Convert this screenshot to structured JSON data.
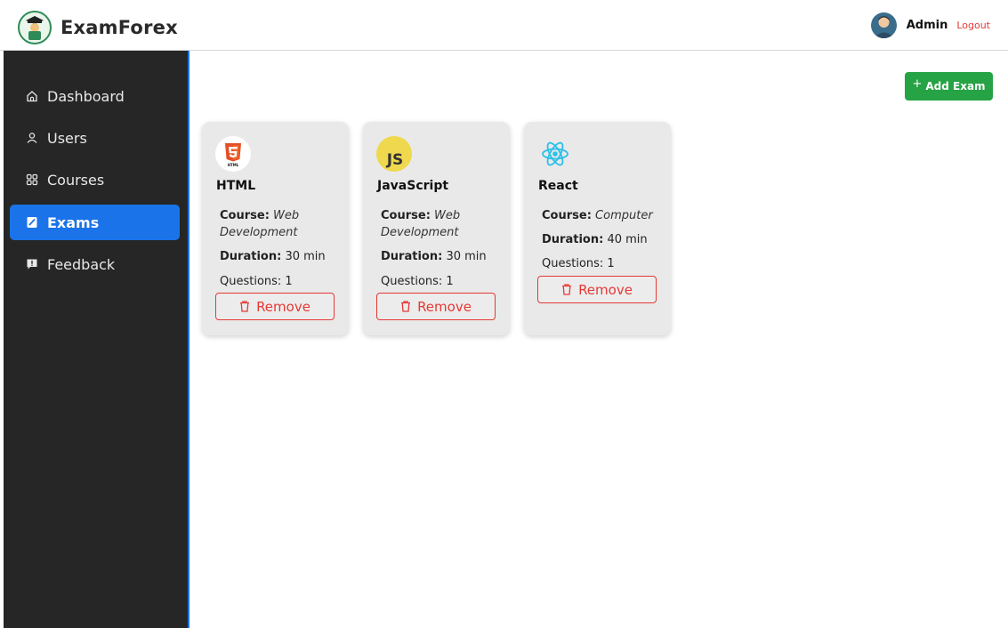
{
  "header": {
    "brand_name": "ExamForex",
    "admin_name": "Admin",
    "logout_label": "Logout"
  },
  "sidebar": {
    "items": [
      {
        "label": "Dashboard",
        "icon": "home-icon",
        "active": false
      },
      {
        "label": "Users",
        "icon": "user-icon",
        "active": false
      },
      {
        "label": "Courses",
        "icon": "grid-icon",
        "active": false
      },
      {
        "label": "Exams",
        "icon": "exam-icon",
        "active": true
      },
      {
        "label": "Feedback",
        "icon": "feedback-icon",
        "active": false
      }
    ]
  },
  "main": {
    "add_button_label": "Add Exam",
    "add_button_icon": "+",
    "cards": [
      {
        "title": "HTML",
        "logo": "html5-icon",
        "course_label": "Course:",
        "course_value": "Web Development",
        "duration_label": "Duration:",
        "duration_value": "30 min",
        "questions_text": "Questions: 1",
        "remove_label": "Remove"
      },
      {
        "title": "JavaScript",
        "logo": "javascript-icon",
        "logo_text": "JS",
        "course_label": "Course:",
        "course_value": "Web Development",
        "duration_label": "Duration:",
        "duration_value": "30 min",
        "questions_text": "Questions: 1",
        "remove_label": "Remove"
      },
      {
        "title": "React",
        "logo": "react-icon",
        "course_label": "Course:",
        "course_value": "Computer",
        "duration_label": "Duration:",
        "duration_value": "40 min",
        "questions_text": "Questions: 1",
        "remove_label": "Remove"
      }
    ]
  },
  "colors": {
    "sidebar_bg": "#262626",
    "active_blue": "#1a73e8",
    "add_green": "#26a344",
    "danger_red": "#e53935",
    "card_bg": "#e9e9e9"
  }
}
